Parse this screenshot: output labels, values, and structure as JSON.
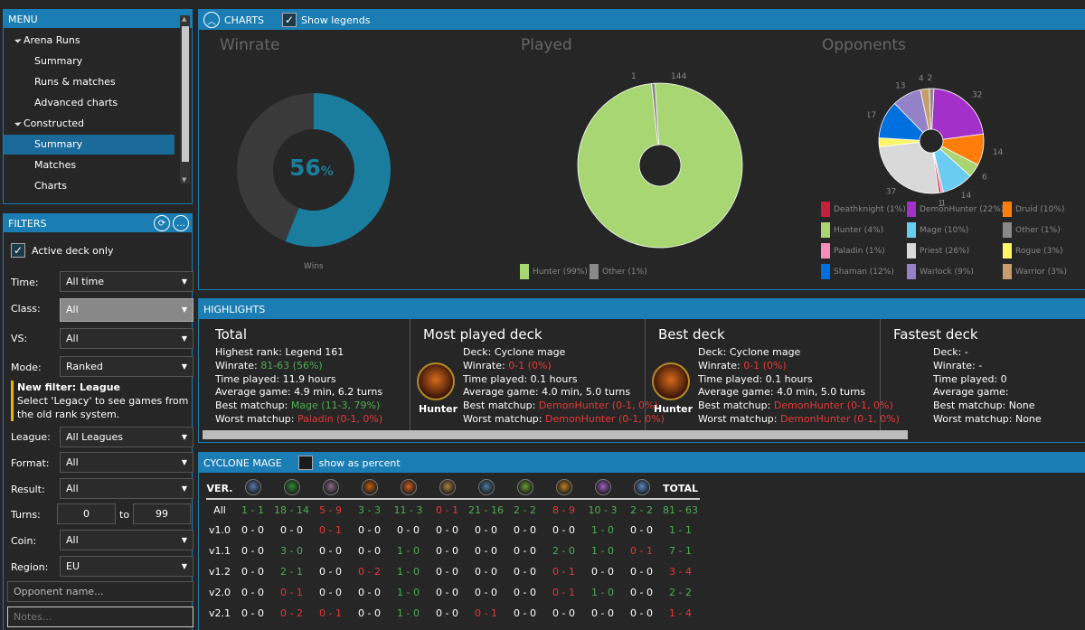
{
  "menu": {
    "title": "MENU",
    "items": [
      {
        "label": "Arena Runs",
        "level": 0
      },
      {
        "label": "Summary",
        "level": 1
      },
      {
        "label": "Runs & matches",
        "level": 1
      },
      {
        "label": "Advanced charts",
        "level": 1
      },
      {
        "label": "Constructed",
        "level": 0
      },
      {
        "label": "Summary",
        "level": 1,
        "selected": true
      },
      {
        "label": "Matches",
        "level": 1
      },
      {
        "label": "Charts",
        "level": 1
      }
    ]
  },
  "filters": {
    "title": "FILTERS",
    "active_deck_label": "Active deck only",
    "time_label": "Time:",
    "time_value": "All time",
    "class_label": "Class:",
    "class_value": "All",
    "vs_label": "VS:",
    "vs_value": "All",
    "mode_label": "Mode:",
    "mode_value": "Ranked",
    "notice_title": "New filter: League",
    "notice_text": "Select 'Legacy' to see games from the old rank system.",
    "league_label": "League:",
    "league_value": "All Leagues",
    "format_label": "Format:",
    "format_value": "All",
    "result_label": "Result:",
    "result_value": "All",
    "turns_label": "Turns:",
    "turns_from": "0",
    "turns_to_label": "to",
    "turns_to": "99",
    "coin_label": "Coin:",
    "coin_value": "All",
    "region_label": "Region:",
    "region_value": "EU",
    "opponent_placeholder": "Opponent name...",
    "notes_placeholder": "Notes..."
  },
  "charts_panel": {
    "title": "CHARTS",
    "show_legends_label": "Show legends",
    "winrate_title": "Winrate",
    "winrate_value": "56",
    "winrate_unit": "%",
    "winrate_caption": "Wins",
    "played_title": "Played",
    "opponents_title": "Opponents"
  },
  "chart_data": [
    {
      "type": "pie",
      "title": "Winrate",
      "categories": [
        "Wins",
        "Losses"
      ],
      "values": [
        56,
        44
      ],
      "colors": [
        "#1a7d9e",
        "#3a3a3a"
      ]
    },
    {
      "type": "pie",
      "title": "Played",
      "categories": [
        "Hunter (99%)",
        "Other (1%)"
      ],
      "values": [
        144,
        1
      ],
      "colors": [
        "#a8d672",
        "#8a8a8a"
      ]
    },
    {
      "type": "pie",
      "title": "Opponents",
      "categories": [
        "Deathknight (1%)",
        "DemonHunter (22%)",
        "Druid (10%)",
        "Hunter (4%)",
        "Mage (10%)",
        "Other (1%)",
        "Paladin (1%)",
        "Priest (26%)",
        "Rogue (3%)",
        "Shaman (12%)",
        "Warlock (9%)",
        "Warrior (3%)"
      ],
      "slices": [
        {
          "label": "DemonHunter",
          "value": 32,
          "color": "#a330c9"
        },
        {
          "label": "Druid",
          "value": 14,
          "color": "#ff7d0a"
        },
        {
          "label": "Hunter",
          "value": 6,
          "color": "#abd473"
        },
        {
          "label": "Mage",
          "value": 14,
          "color": "#69ccf0"
        },
        {
          "label": "Paladin",
          "value": 1,
          "color": "#f58cba"
        },
        {
          "label": "Deathknight",
          "value": 1,
          "color": "#c41f3b"
        },
        {
          "label": "Priest",
          "value": 37,
          "color": "#d9d9d9"
        },
        {
          "label": "Rogue",
          "value": 4,
          "color": "#fff569"
        },
        {
          "label": "Shaman",
          "value": 17,
          "color": "#0070de"
        },
        {
          "label": "Warlock",
          "value": 13,
          "color": "#9482c9"
        },
        {
          "label": "Warrior",
          "value": 4,
          "color": "#c79c6e"
        },
        {
          "label": "Other",
          "value": 2,
          "color": "#8a8a8a"
        }
      ],
      "slice_labels": [
        "32",
        "14",
        "6",
        "14",
        "1",
        "1",
        "37",
        "4",
        "17",
        "13",
        "4",
        "2"
      ]
    }
  ],
  "legends": {
    "played": [
      {
        "label": "Hunter (99%)",
        "color": "#a8d672"
      },
      {
        "label": "Other (1%)",
        "color": "#8a8a8a"
      }
    ],
    "opponents": [
      {
        "label": "Deathknight (1%)",
        "color": "#c41f3b"
      },
      {
        "label": "DemonHunter (22%)",
        "color": "#a330c9"
      },
      {
        "label": "Druid (10%)",
        "color": "#ff7d0a"
      },
      {
        "label": "Hunter (4%)",
        "color": "#abd473"
      },
      {
        "label": "Mage (10%)",
        "color": "#69ccf0"
      },
      {
        "label": "Other (1%)",
        "color": "#8a8a8a"
      },
      {
        "label": "Paladin (1%)",
        "color": "#f58cba"
      },
      {
        "label": "Priest (26%)",
        "color": "#d9d9d9"
      },
      {
        "label": "Rogue (3%)",
        "color": "#fff569"
      },
      {
        "label": "Shaman (12%)",
        "color": "#0070de"
      },
      {
        "label": "Warlock (9%)",
        "color": "#9482c9"
      },
      {
        "label": "Warrior (3%)",
        "color": "#c79c6e"
      }
    ]
  },
  "highlights": {
    "title": "HIGHLIGHTS",
    "total": {
      "title": "Total",
      "highest_rank": "Highest rank: Legend 161",
      "winrate_label": "Winrate: ",
      "winrate_value": "81-63 (56%)",
      "time_played": "Time played: 11.9 hours",
      "average_game": "Average game: 4.9 min, 6.2 turns",
      "best_label": "Best matchup: ",
      "best_value": "Mage (11-3, 79%)",
      "worst_label": "Worst matchup: ",
      "worst_value": "Paladin (0-1, 0%)"
    },
    "most_played": {
      "title": "Most played deck",
      "class_name": "Hunter",
      "deck": "Deck: Cyclone mage",
      "winrate_label": "Winrate: ",
      "winrate_value": "0-1 (0%)",
      "time_played": "Time played: 0.1 hours",
      "average_game": "Average game: 4.0 min, 5.0 turns",
      "best_label": "Best matchup: ",
      "best_value": "DemonHunter (0-1, 0%)",
      "worst_label": "Worst matchup: ",
      "worst_value": "DemonHunter (0-1, 0%)"
    },
    "best": {
      "title": "Best deck",
      "class_name": "Hunter",
      "deck": "Deck: Cyclone mage",
      "winrate_label": "Winrate: ",
      "winrate_value": "0-1 (0%)",
      "time_played": "Time played: 0.1 hours",
      "average_game": "Average game: 4.0 min, 5.0 turns",
      "best_label": "Best matchup: ",
      "best_value": "DemonHunter (0-1, 0%)",
      "worst_label": "Worst matchup: ",
      "worst_value": "DemonHunter (0-1, 0%)"
    },
    "fastest": {
      "title": "Fastest deck",
      "deck": "Deck: -",
      "winrate": "Winrate: -",
      "time_played": "Time played: 0",
      "average_game": "Average game:",
      "best": "Best matchup: None",
      "worst": "Worst matchup: None"
    }
  },
  "deck_table": {
    "title": "CYCLONE MAGE",
    "show_percent_label": "show as percent",
    "ver_header": "VER.",
    "total_header": "TOTAL",
    "class_icons": [
      "demonhunter-icon",
      "druid-icon",
      "hunter-icon",
      "mage-icon",
      "paladin-icon",
      "priest-icon",
      "rogue-icon",
      "shaman-icon",
      "warlock-icon",
      "warrior-icon",
      "deathknight-icon"
    ],
    "class_icon_colors": [
      "#5a7ab0",
      "#2f8a2f",
      "#8a6a8a",
      "#c06010",
      "#d06020",
      "#b08040",
      "#4a7aa0",
      "#6a9a30",
      "#c08020",
      "#a060c0",
      "#5a8ac0"
    ],
    "rows": [
      {
        "ver": "All",
        "cells": [
          [
            "1 - 1",
            "g"
          ],
          [
            "18 - 14",
            "g"
          ],
          [
            "5 - 9",
            "r"
          ],
          [
            "3 - 3",
            "g"
          ],
          [
            "11 - 3",
            "g"
          ],
          [
            "0 - 1",
            "r"
          ],
          [
            "21 - 16",
            "g"
          ],
          [
            "2 - 2",
            "g"
          ],
          [
            "8 - 9",
            "r"
          ],
          [
            "10 - 3",
            "g"
          ],
          [
            "2 - 2",
            "g"
          ],
          [
            "81 - 63",
            "g"
          ]
        ]
      },
      {
        "ver": "v1.0",
        "cells": [
          [
            "0 - 0",
            "w"
          ],
          [
            "0 - 0",
            "w"
          ],
          [
            "0 - 1",
            "r"
          ],
          [
            "0 - 0",
            "w"
          ],
          [
            "0 - 0",
            "w"
          ],
          [
            "0 - 0",
            "w"
          ],
          [
            "0 - 0",
            "w"
          ],
          [
            "0 - 0",
            "w"
          ],
          [
            "0 - 0",
            "w"
          ],
          [
            "1 - 0",
            "g"
          ],
          [
            "0 - 0",
            "w"
          ],
          [
            "1 - 1",
            "g"
          ]
        ]
      },
      {
        "ver": "v1.1",
        "cells": [
          [
            "0 - 0",
            "w"
          ],
          [
            "3 - 0",
            "g"
          ],
          [
            "0 - 0",
            "w"
          ],
          [
            "0 - 0",
            "w"
          ],
          [
            "1 - 0",
            "g"
          ],
          [
            "0 - 0",
            "w"
          ],
          [
            "0 - 0",
            "w"
          ],
          [
            "0 - 0",
            "w"
          ],
          [
            "2 - 0",
            "g"
          ],
          [
            "1 - 0",
            "g"
          ],
          [
            "0 - 1",
            "r"
          ],
          [
            "7 - 1",
            "g"
          ]
        ]
      },
      {
        "ver": "v1.2",
        "cells": [
          [
            "0 - 0",
            "w"
          ],
          [
            "2 - 1",
            "g"
          ],
          [
            "0 - 0",
            "w"
          ],
          [
            "0 - 2",
            "r"
          ],
          [
            "1 - 0",
            "g"
          ],
          [
            "0 - 0",
            "w"
          ],
          [
            "0 - 0",
            "w"
          ],
          [
            "0 - 0",
            "w"
          ],
          [
            "0 - 1",
            "r"
          ],
          [
            "0 - 0",
            "w"
          ],
          [
            "0 - 0",
            "w"
          ],
          [
            "3 - 4",
            "r"
          ]
        ]
      },
      {
        "ver": "v2.0",
        "cells": [
          [
            "0 - 0",
            "w"
          ],
          [
            "0 - 1",
            "r"
          ],
          [
            "0 - 0",
            "w"
          ],
          [
            "0 - 0",
            "w"
          ],
          [
            "1 - 0",
            "g"
          ],
          [
            "0 - 0",
            "w"
          ],
          [
            "0 - 0",
            "w"
          ],
          [
            "0 - 0",
            "w"
          ],
          [
            "0 - 1",
            "r"
          ],
          [
            "1 - 0",
            "g"
          ],
          [
            "0 - 0",
            "w"
          ],
          [
            "2 - 2",
            "g"
          ]
        ]
      },
      {
        "ver": "v2.1",
        "cells": [
          [
            "0 - 0",
            "w"
          ],
          [
            "0 - 2",
            "r"
          ],
          [
            "0 - 1",
            "r"
          ],
          [
            "0 - 0",
            "w"
          ],
          [
            "1 - 0",
            "g"
          ],
          [
            "0 - 0",
            "w"
          ],
          [
            "0 - 1",
            "r"
          ],
          [
            "0 - 0",
            "w"
          ],
          [
            "0 - 0",
            "w"
          ],
          [
            "0 - 0",
            "w"
          ],
          [
            "0 - 0",
            "w"
          ],
          [
            "1 - 4",
            "r"
          ]
        ]
      }
    ]
  }
}
